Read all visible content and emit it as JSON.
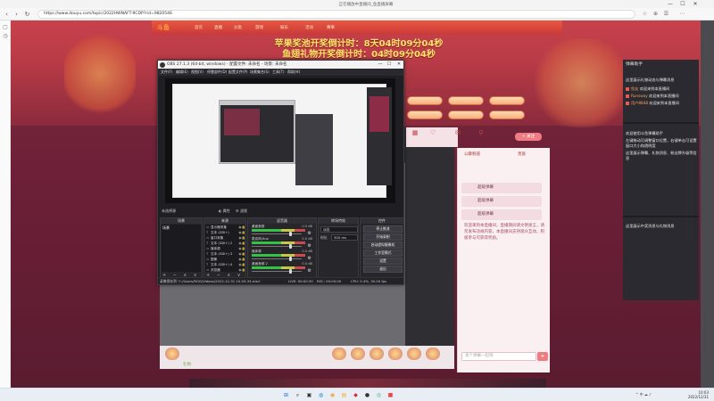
{
  "browser": {
    "window_title": "正在播放中直播间_鱼直播屏幕",
    "url": "https://www.douyu.com/topic/2022HWNAFT-9CDP?rid=9820546",
    "controls": {
      "minimize": "—",
      "maximize": "☐",
      "close": "✕"
    },
    "nav": {
      "back": "‹",
      "forward": "›",
      "reload": "↻"
    },
    "toolbar_icons": [
      "☆",
      "⊕",
      "☰",
      "⋯"
    ]
  },
  "site": {
    "logo": "斗鱼",
    "nav_links": [
      "首页",
      "直播",
      "分类",
      "游戏",
      "娱乐",
      "活动",
      "赛事"
    ],
    "timer_apple": "苹果奖池开奖倒计时：8天04时09分04秒",
    "timer_fish": "鱼翅礼物开奖倒计时：04时09分04秒",
    "prize_buttons": [
      "",
      "",
      "",
      "",
      "",
      ""
    ],
    "room_icons": [
      "▦",
      "♡",
      "✉",
      "⚲"
    ],
    "follow": "+ 关注",
    "chat_tabs": [
      "公聊频道",
      "贵族"
    ],
    "chat_rows": [
      "超级弹幕",
      "超级弹幕",
      "超级弹幕"
    ],
    "chat_message": "欢迎来到本直播间，直播期间请文明发言，请勿发布违规内容，本直播间支持观众互动，积极参与可获得奖励。",
    "chat_placeholder": "发个弹幕一起嗨",
    "chat_send": "➤",
    "gift_label": "礼物"
  },
  "obs": {
    "title": "OBS 27.1.3 (64-bit, windows) - 配置文件: 未命名 - 场景: 未命名",
    "menu": [
      "文件(F)",
      "编辑(E)",
      "视图(V)",
      "停靠部件(D)",
      "配置文件(P)",
      "场景集合(S)",
      "工具(T)",
      "帮助(H)"
    ],
    "preview_label": "未选择源",
    "studio_label": "◐ 属性",
    "filters_label": "⚙ 滤镜",
    "docks": {
      "scenes": "场景",
      "sources": "来源",
      "mixer": "混音器",
      "transitions": "转场特效",
      "controls": "控件"
    },
    "scene_item": "场景",
    "sources": [
      {
        "icon": "▭",
        "name": "显示器采集"
      },
      {
        "icon": "T",
        "name": "文本 (GDI+)"
      },
      {
        "icon": "▭",
        "name": "窗口采集"
      },
      {
        "icon": "T",
        "name": "文本 (GDI+) 2"
      },
      {
        "icon": "▭",
        "name": "媒体源"
      },
      {
        "icon": "T",
        "name": "文本 (GDI+) 3"
      },
      {
        "icon": "▭",
        "name": "图像"
      },
      {
        "icon": "T",
        "name": "文本 (GDI+) 4"
      },
      {
        "icon": "▭",
        "name": "浏览器"
      }
    ],
    "mixer": [
      {
        "name": "桌面音频",
        "db": "0.0 dB",
        "level": 0.8
      },
      {
        "name": "麦克风/Aux",
        "db": "0.0 dB",
        "level": 0.8
      },
      {
        "name": "媒体源",
        "db": "0.0 dB",
        "level": 0.8
      },
      {
        "name": "桌面音频 2",
        "db": "0.0 dB",
        "level": 0.8
      }
    ],
    "transition": "淡出",
    "duration_label": "时长",
    "duration": "300 ms",
    "controls": [
      "停止推流",
      "开始录制",
      "启动虚拟摄像机",
      "工作室模式",
      "设置",
      "退出"
    ],
    "dock_footer": "+ − ∧ ∨",
    "status": {
      "recording": "录像保存到 'C:/Users/ROG/Videos/2022-12-31 10-03-34.mkv'",
      "live": "LIVE: 00:00:30",
      "rec": "REC: 00:00:00",
      "cpu": "CPU: 5.4%, 30.00 fps"
    }
  },
  "right_panel": {
    "header": "弹幕助手",
    "lines": [
      "这里展示礼物动态与弹幕消息",
      "欢迎使用斗鱼弹幕助手",
      "左键拖动可调整窗口位置，右键单击可设置窗口大小和透明度",
      "这里展示弹幕、礼物消息、粉丝牌升级等信息",
      "这里展示中奖消息与礼物消息"
    ],
    "users": [
      {
        "name": "鱼友",
        "msg": "欢迎来到本直播间"
      },
      {
        "name": "Runsway",
        "msg": "欢迎来到本直播间"
      },
      {
        "name": "用户8848",
        "msg": "欢迎来到本直播间"
      }
    ]
  },
  "taskbar": {
    "icons": [
      "⊞",
      "⌕",
      "▣",
      "◍",
      "◉",
      "▤",
      "◆",
      "●",
      "◎",
      "■"
    ],
    "tray": "^ 中 ☁ ♪",
    "time": "10:03",
    "date": "2022/12/31"
  }
}
